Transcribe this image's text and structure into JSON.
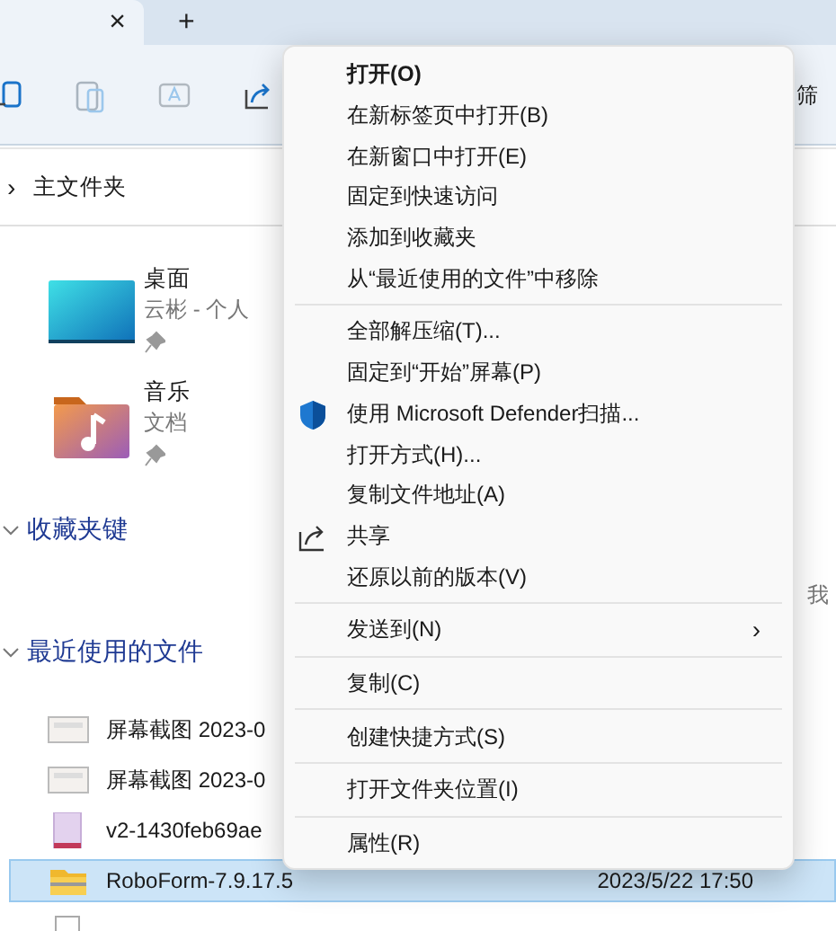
{
  "tabs": {
    "close": "×",
    "new_tab": "+"
  },
  "toolbar": {
    "filter": "筛"
  },
  "breadcrumb": {
    "chevron": "›",
    "location": "主文件夹"
  },
  "quick_access": [
    {
      "kind": "desktop",
      "name": "桌面",
      "detail": "云彬 - 个人"
    },
    {
      "kind": "music",
      "name": "音乐",
      "detail": "文档"
    }
  ],
  "favorites": {
    "title": "收藏夹键",
    "empty_note": "我"
  },
  "recent": {
    "title": "最近使用的文件",
    "files": [
      {
        "kind": "image",
        "name": "屏幕截图 2023-0",
        "selected": false
      },
      {
        "kind": "image",
        "name": "屏幕截图 2023-0",
        "selected": false
      },
      {
        "kind": "document",
        "name": "v2-1430feb69ae",
        "selected": false
      },
      {
        "kind": "zip",
        "name": "RoboForm-7.9.17.5",
        "date": "2023/5/22 17:50",
        "selected": true
      },
      {
        "kind": "blank",
        "selected": false
      }
    ]
  },
  "context_menu": {
    "groups": [
      [
        {
          "label": "打开(O)",
          "default": true
        },
        {
          "label": "在新标签页中打开(B)",
          "default": false
        },
        {
          "label": "在新窗口中打开(E)",
          "default": false
        },
        {
          "label": "固定到快速访问",
          "default": false
        },
        {
          "label": "添加到收藏夹",
          "default": false
        },
        {
          "label": "从“最近使用的文件”中移除",
          "default": false
        }
      ],
      [
        {
          "label": "全部解压缩(T)...",
          "default": false
        },
        {
          "label": "固定到“开始”屏幕(P)",
          "default": false
        },
        {
          "label": "使用 Microsoft Defender扫描...",
          "kind": "security",
          "default": false
        },
        {
          "label": "打开方式(H)...",
          "default": false
        },
        {
          "label": "复制文件地址(A)",
          "default": false
        },
        {
          "label": "共享",
          "kind": "share",
          "default": false
        },
        {
          "label": "还原以前的版本(V)",
          "default": false
        }
      ],
      [
        {
          "label": "发送到(N)",
          "kind": "submenu",
          "arrow": "›",
          "default": false
        }
      ],
      [
        {
          "label": "复制(C)",
          "default": false
        }
      ],
      [
        {
          "label": "创建快捷方式(S)",
          "default": false
        }
      ],
      [
        {
          "label": "打开文件夹位置(I)",
          "default": false
        }
      ],
      [
        {
          "label": "属性(R)",
          "default": false
        }
      ]
    ]
  }
}
